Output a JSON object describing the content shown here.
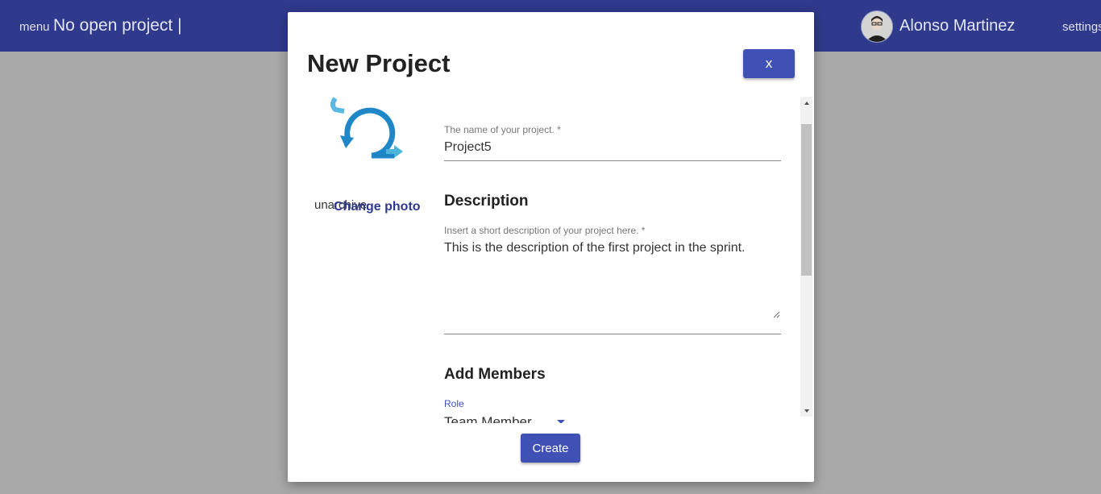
{
  "appbar": {
    "menu_label": "menu",
    "project_status": "No open project |",
    "user_name": "Alonso Martinez",
    "settings_label": "settings"
  },
  "modal": {
    "title": "New Project",
    "close_label": "x",
    "photo": {
      "unarchive_label": "unarchive",
      "change_photo_label": "Change photo",
      "logo_icon": "scrum-cycle-icon"
    },
    "name_field": {
      "label": "The name of your project. *",
      "value": "Project5"
    },
    "description": {
      "section_title": "Description",
      "label": "Insert a short description of your project here. *",
      "value": "This is the description of the first project in the sprint."
    },
    "members": {
      "section_title": "Add Members",
      "role_label": "Role",
      "role_value": "Team Member"
    },
    "create_label": "Create"
  },
  "colors": {
    "appbar": "#2f3a8d",
    "accent": "#3f51b5",
    "overlay": "#a9a9a9"
  }
}
